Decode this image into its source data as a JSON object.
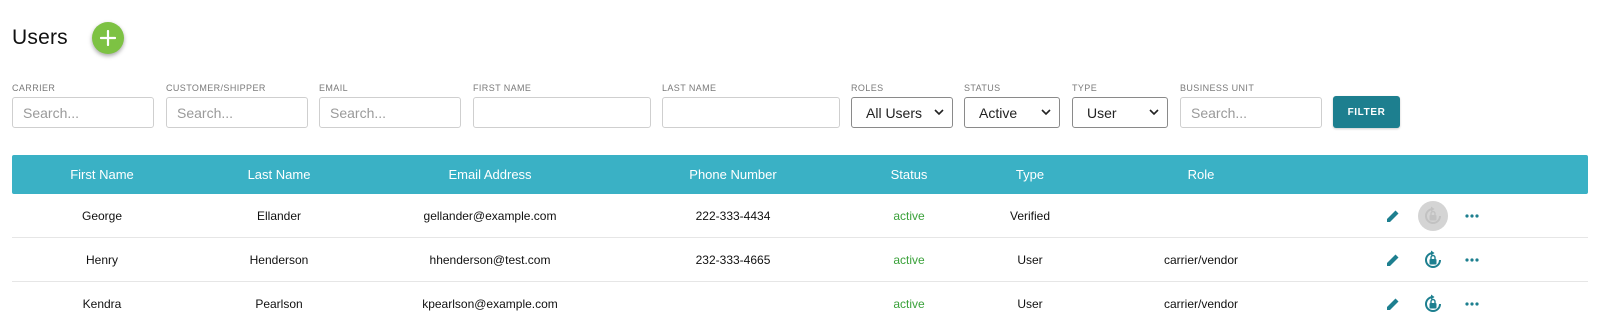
{
  "page": {
    "title": "Users"
  },
  "filters": {
    "carrier": {
      "label": "CARRIER",
      "placeholder": "Search..."
    },
    "customer_shipper": {
      "label": "CUSTOMER/SHIPPER",
      "placeholder": "Search..."
    },
    "email": {
      "label": "EMAIL",
      "placeholder": "Search..."
    },
    "first_name": {
      "label": "FIRST NAME",
      "placeholder": ""
    },
    "last_name": {
      "label": "LAST NAME",
      "placeholder": ""
    },
    "roles": {
      "label": "ROLES",
      "value": "All Users"
    },
    "status": {
      "label": "STATUS",
      "value": "Active"
    },
    "type": {
      "label": "TYPE",
      "value": "User"
    },
    "business_unit": {
      "label": "BUSINESS UNIT",
      "placeholder": "Search..."
    },
    "button_label": "FILTER"
  },
  "table": {
    "headers": [
      "First Name",
      "Last Name",
      "Email Address",
      "Phone Number",
      "Status",
      "Type",
      "Role"
    ],
    "rows": [
      {
        "first_name": "George",
        "last_name": "Ellander",
        "email": "gellander@example.com",
        "phone": "222-333-4434",
        "status": "active",
        "type": "Verified",
        "role": "",
        "unlock_disabled": true
      },
      {
        "first_name": "Henry",
        "last_name": "Henderson",
        "email": "hhenderson@test.com",
        "phone": "232-333-4665",
        "status": "active",
        "type": "User",
        "role": "carrier/vendor",
        "unlock_disabled": false
      },
      {
        "first_name": "Kendra",
        "last_name": "Pearlson",
        "email": "kpearlson@example.com",
        "phone": "",
        "status": "active",
        "type": "User",
        "role": "carrier/vendor",
        "unlock_disabled": false
      }
    ]
  },
  "colors": {
    "header_bg": "#3ab1c5",
    "add_button": "#7dc243",
    "filter_button": "#1d7f8f",
    "status_active": "#3aa13a",
    "action_icon": "#1d7f8f"
  },
  "icons": {
    "add": "plus-icon",
    "edit": "pencil-icon",
    "unlock": "unlock-reset-icon",
    "more": "more-horizontal-icon"
  }
}
